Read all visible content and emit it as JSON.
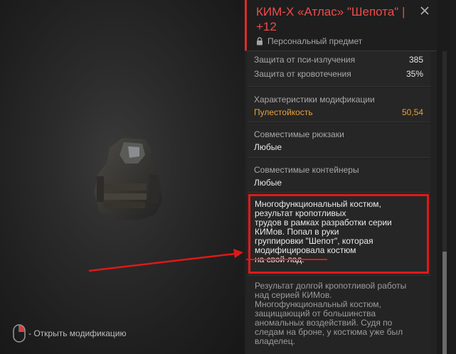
{
  "item": {
    "title": "КИМ-Х «Атлас» \"Шепота\" | +12",
    "personal": "Персональный предмет"
  },
  "stats": [
    {
      "label": "Защита от пси-излучения",
      "value": "385"
    },
    {
      "label": "Защита от кровотечения",
      "value": "35%"
    }
  ],
  "mods": {
    "header": "Характеристики модификации",
    "label": "Пулестойкость",
    "value": "50,54"
  },
  "backpacks": {
    "header": "Совместимые рюкзаки",
    "value": "Любые"
  },
  "containers": {
    "header": "Совместимые контейнеры",
    "value": "Любые"
  },
  "description": [
    "Многофункциональный костюм,",
    "результат кропотливых",
    "трудов в рамках разработки серии",
    "КИМов. Попал в руки",
    "группировки \"Шепот\", которая",
    "модифицировала костюм",
    "на свой лад."
  ],
  "lore": [
    "Результат долгой кропотливой работы",
    "над серией КИМов.",
    "Многофункциональный костюм,",
    "защищающий от большинства",
    "аномальных воздействий. Судя по",
    "следам на броне, у костюма уже был",
    "владелец."
  ],
  "hint": "- Открыть модификацию",
  "colors": {
    "accent": "#e02b2b",
    "orange": "#e8a23a"
  }
}
